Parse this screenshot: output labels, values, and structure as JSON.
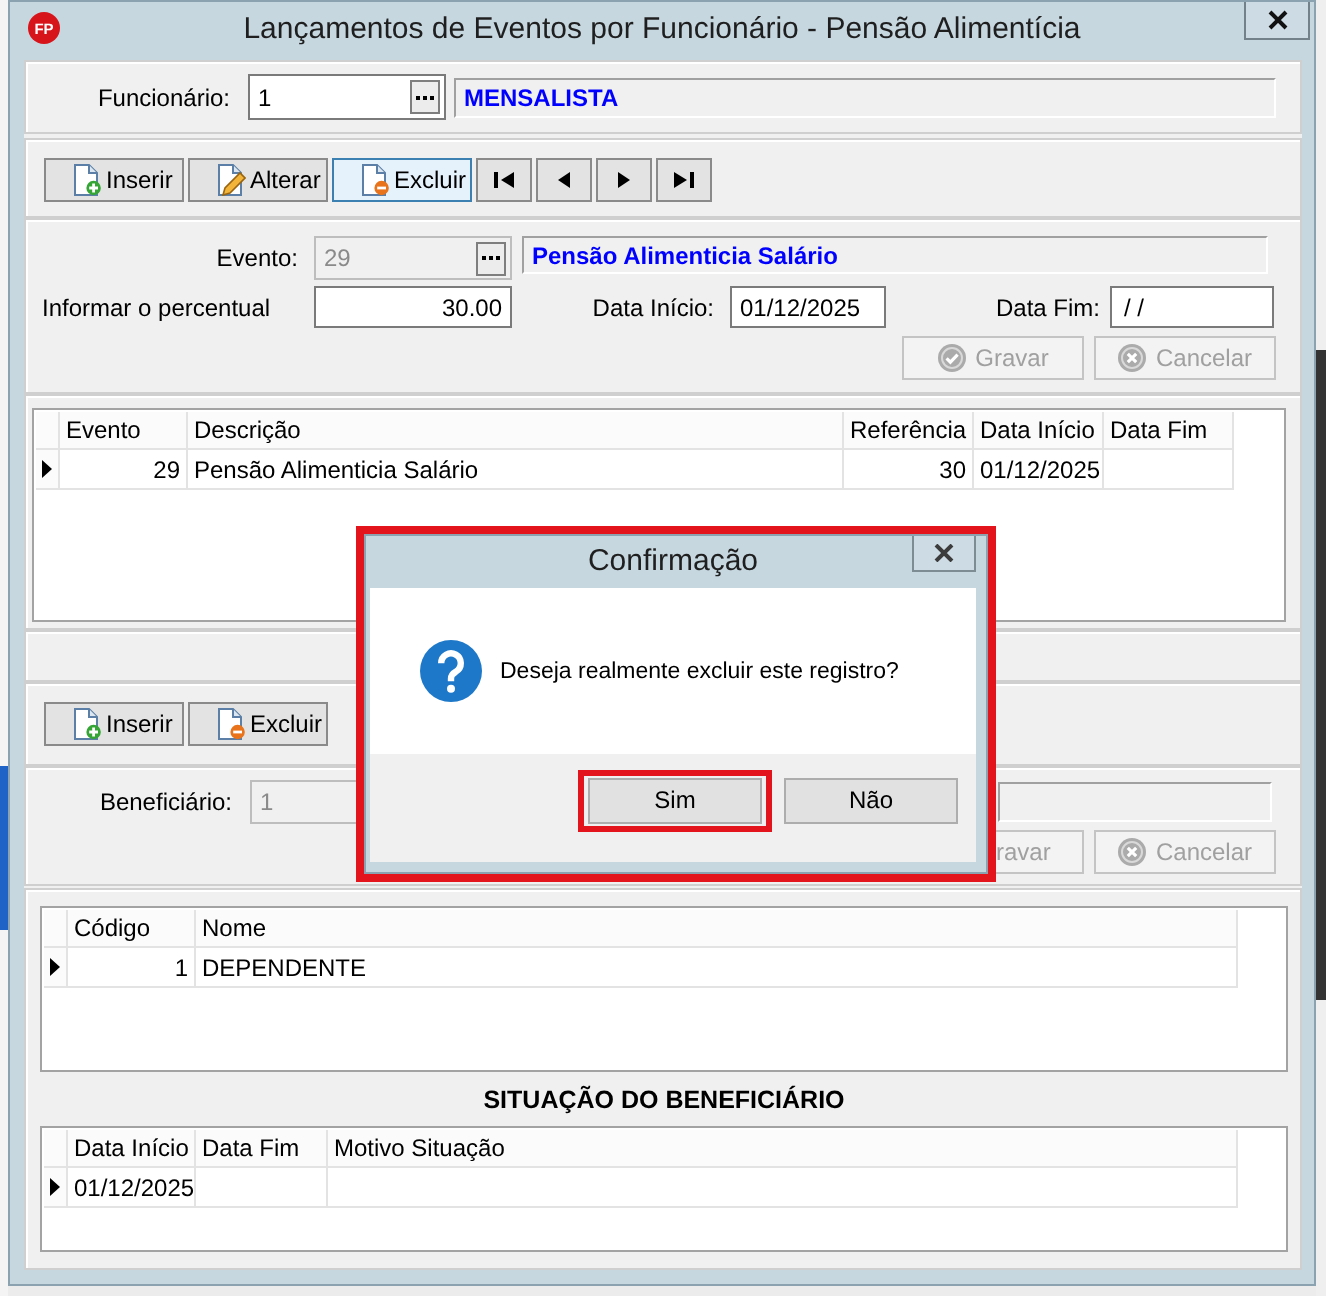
{
  "window": {
    "logo": "FP",
    "title": "Lançamentos de Eventos por Funcionário - Pensão Alimentícia"
  },
  "employee": {
    "label": "Funcionário:",
    "value": "1",
    "name": "MENSALISTA"
  },
  "toolbar": [
    {
      "kind": "insert",
      "label": "Inserir",
      "focused": false
    },
    {
      "kind": "edit",
      "label": "Alterar",
      "focused": false
    },
    {
      "kind": "delete",
      "label": "Excluir",
      "focused": true
    },
    {
      "kind": "first",
      "focused": false
    },
    {
      "kind": "previous",
      "focused": false
    },
    {
      "kind": "next",
      "focused": false
    },
    {
      "kind": "last",
      "focused": false
    }
  ],
  "event_form": {
    "event_label": "Evento:",
    "event_code": "29",
    "event_code_disabled": true,
    "event_name": "Pensão Alimenticia Salário",
    "percent_label": "Informar o percentual",
    "percent": "30.00",
    "start_label": "Data Início:",
    "start_date": "01/12/2025",
    "end_label": "Data Fim:",
    "end_date": "/ /",
    "buttons": [
      {
        "kind": "save",
        "label": "Gravar",
        "disabled": true
      },
      {
        "kind": "cancel",
        "label": "Cancelar",
        "disabled": true
      }
    ]
  },
  "events_table": {
    "columns": [
      {
        "label": "Evento",
        "kind": "number"
      },
      {
        "label": "Descrição",
        "kind": "text"
      },
      {
        "label": "Referência",
        "kind": "number"
      },
      {
        "label": "Data Início",
        "kind": "text"
      },
      {
        "label": "Data Fim",
        "kind": "text"
      }
    ],
    "rows": [
      {
        "selected": true,
        "cells": [
          "29",
          "Pensão Alimenticia Salário",
          "30",
          "01/12/2025"
        ]
      }
    ]
  },
  "dependents_toolbar": [
    {
      "kind": "insert",
      "label": "Inserir",
      "focused": false
    },
    {
      "kind": "delete",
      "label": "Excluir",
      "focused": false
    }
  ],
  "beneficiary": {
    "label": "Beneficiário:",
    "value": "1",
    "disabled": true,
    "buttons": [
      {
        "kind": "covered",
        "label": "ravar",
        "disabled": true
      },
      {
        "kind": "cancel",
        "label": "Cancelar",
        "disabled": true
      }
    ]
  },
  "dependents_table": {
    "columns": [
      {
        "label": "Código",
        "kind": "number"
      },
      {
        "label": "Nome",
        "kind": "text"
      }
    ],
    "rows": [
      {
        "selected": true,
        "cells": [
          "1",
          "DEPENDENTE"
        ]
      }
    ]
  },
  "status_title": "SITUAÇÃO DO BENEFICIÁRIO",
  "status_table": {
    "columns": [
      {
        "label": "Data Início",
        "kind": "text"
      },
      {
        "label": "Data Fim",
        "kind": "text"
      },
      {
        "label": "Motivo Situação",
        "kind": "text"
      }
    ],
    "rows": [
      {
        "selected": true,
        "cells": [
          "01/12/2025"
        ]
      }
    ]
  },
  "dialog": {
    "title": "Confirmação",
    "message": "Deseja realmente excluir este registro?",
    "highlighted": true,
    "buttons": [
      {
        "label": "Sim",
        "highlighted": true
      },
      {
        "label": "Não",
        "highlighted": false
      }
    ]
  }
}
